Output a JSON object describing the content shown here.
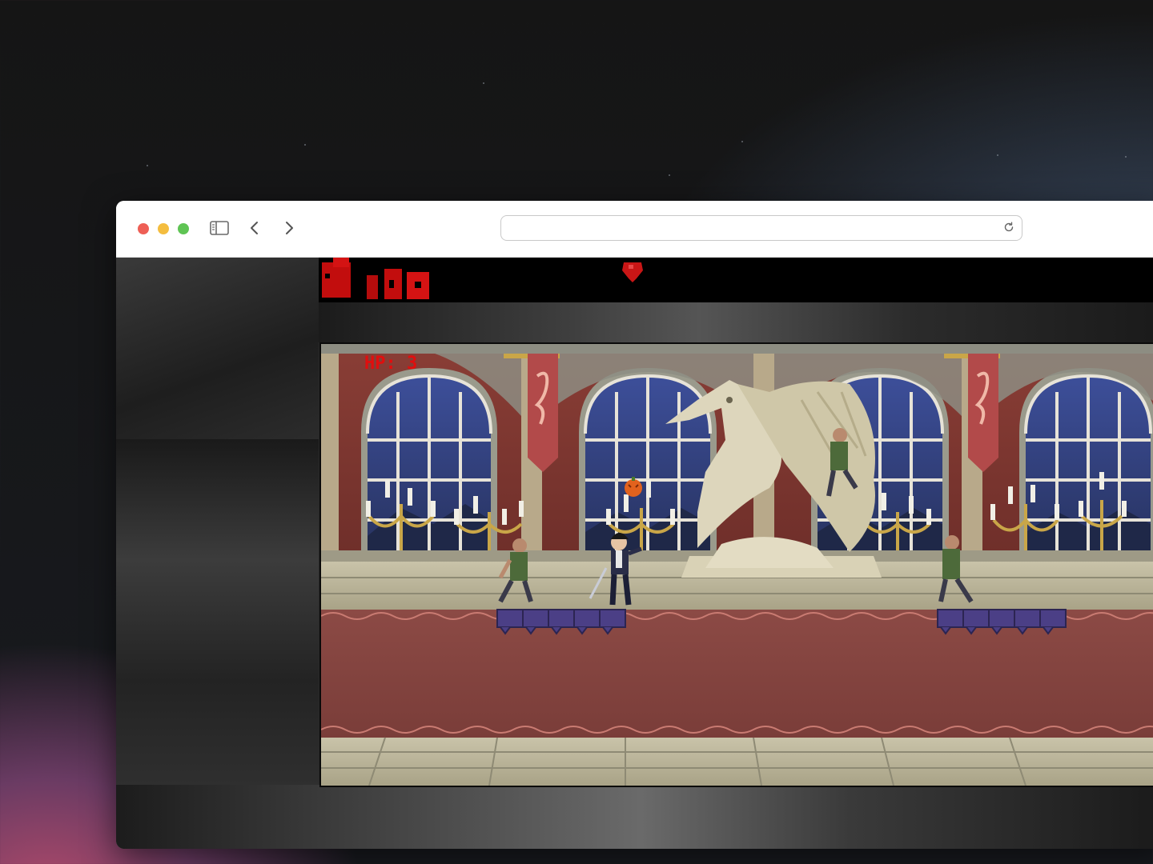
{
  "browser": {
    "address_value": "",
    "address_placeholder": "",
    "icons": [
      "sidebar-icon",
      "chevron-left-icon",
      "chevron-right-icon",
      "reload-icon"
    ]
  },
  "game": {
    "hud": {
      "hp_text": "HP: 3"
    }
  },
  "colors": {
    "hp": "#e10e0e",
    "traffic_red": "#ee5f56",
    "traffic_yellow": "#f4bd3f",
    "traffic_green": "#5fc454"
  }
}
